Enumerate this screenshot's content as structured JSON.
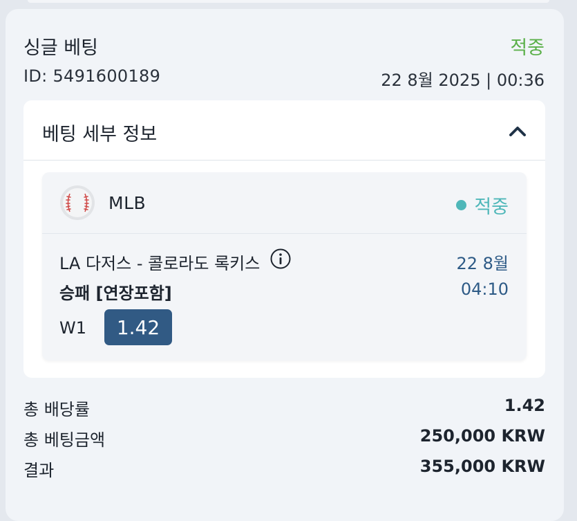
{
  "bet": {
    "title": "싱글 베팅",
    "status": "적중",
    "id_text": "ID: 5491600189",
    "datetime": "22 8월 2025 | 00:36"
  },
  "details": {
    "title": "베팅 세부 정보",
    "chevron_icon": "chevron-up-icon",
    "event": {
      "sport_icon": "baseball-icon",
      "league": "MLB",
      "status": "적중",
      "match": "LA 다저스 - 콜로라도 록키스",
      "date": "22 8월",
      "time": "04:10",
      "market": "승패 [연장포함]",
      "selection": "W1",
      "odds": "1.42"
    }
  },
  "summary": {
    "total_odds_label": "총 배당률",
    "total_odds_value": "1.42",
    "total_stake_label": "총 베팅금액",
    "total_stake_value": "250,000 KRW",
    "result_label": "결과",
    "result_value": "355,000 KRW"
  },
  "colors": {
    "win_green": "#5bb04a",
    "win_teal": "#4fb7b9",
    "odds_badge": "#315a84",
    "date_blue": "#2d5a86"
  }
}
